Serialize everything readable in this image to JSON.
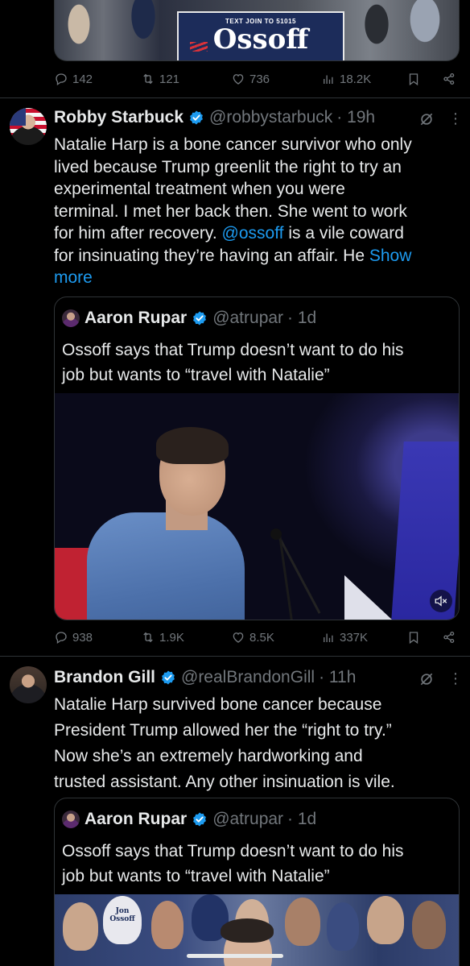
{
  "top_tweet": {
    "sign_small": "TEXT JOIN TO 51015",
    "sign_big": "Ossoff",
    "stats": {
      "replies": "142",
      "reposts": "121",
      "likes": "736",
      "views": "18.2K"
    }
  },
  "tweet1": {
    "name": "Robby Starbuck",
    "handle": "@robbystarbuck",
    "time": "· 19h",
    "lines": [
      "Natalie Harp is a bone cancer survivor who only",
      "lived because Trump greenlit the right to try an",
      "experimental treatment when you were",
      "terminal. I met her back then. She went to work"
    ],
    "line5_pre": "for him after recovery. ",
    "line5_mention": "@ossoff",
    "line5_post": " is a vile coward",
    "line6_pre": "for insinuating they’re having an affair. He ",
    "show_more_1": "Show",
    "show_more_2": "more",
    "quote": {
      "name": "Aaron Rupar",
      "handle": "@atrupar",
      "time": "· 1d",
      "text_line1": "Ossoff says that Trump doesn’t want to do his",
      "text_line2": "job but wants to “travel with Natalie”"
    },
    "stats": {
      "replies": "938",
      "reposts": "1.9K",
      "likes": "8.5K",
      "views": "337K"
    }
  },
  "tweet2": {
    "name": "Brandon Gill",
    "handle": "@realBrandonGill",
    "time": "· 11h",
    "lines": [
      "Natalie Harp survived bone cancer because",
      "President Trump allowed her the “right to try.”",
      "Now she’s an extremely hardworking and",
      "trusted assistant. Any other insinuation is vile."
    ],
    "quote": {
      "name": "Aaron Rupar",
      "handle": "@atrupar",
      "time": "· 1d",
      "text_line1": "Ossoff says that Trump doesn’t want to do his",
      "text_line2": "job but wants to “travel with Natalie”",
      "sign_text": "Jon Ossoff"
    }
  },
  "colors": {
    "background": "#000000",
    "text": "#e7e9ea",
    "secondary": "#71767b",
    "accent": "#1d9bf0",
    "border": "#2f3336"
  }
}
